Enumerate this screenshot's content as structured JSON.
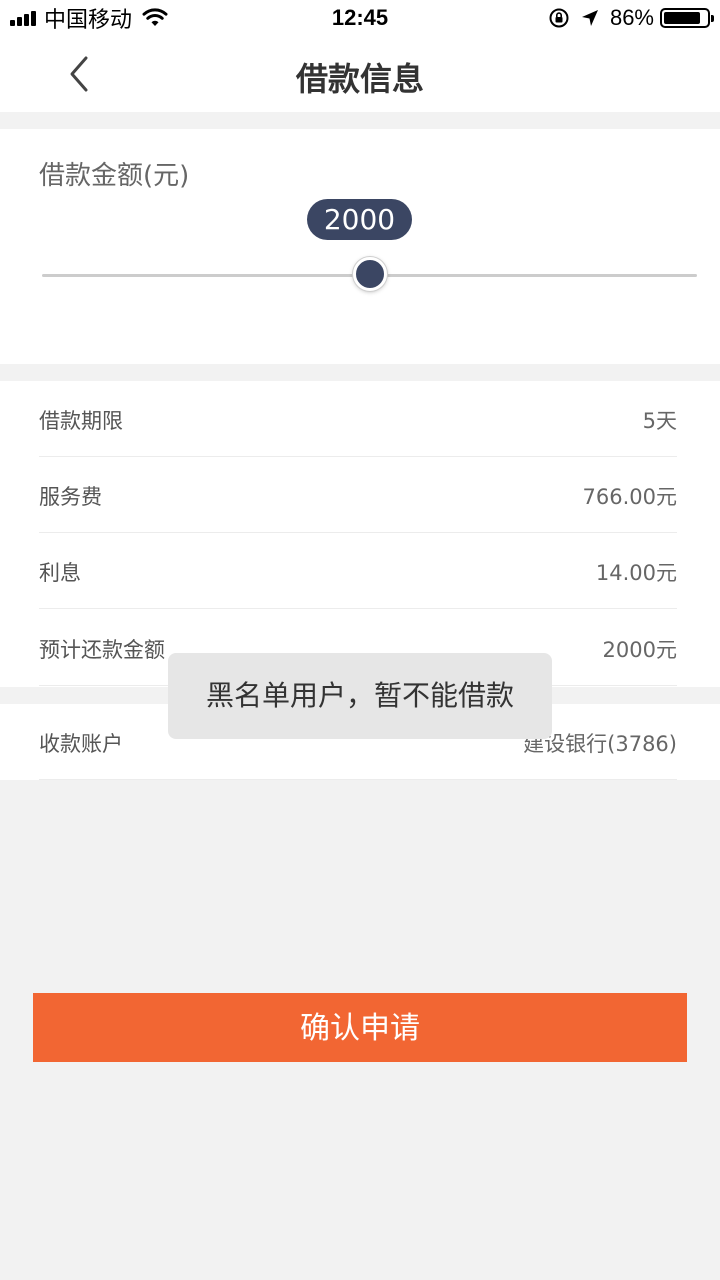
{
  "status_bar": {
    "carrier": "中国移动",
    "time": "12:45",
    "battery_percent": "86%",
    "battery_level": 0.86,
    "icons": [
      "signal-icon",
      "wifi-icon",
      "rotation-lock-icon",
      "location-arrow-icon",
      "battery-icon"
    ]
  },
  "nav": {
    "title": "借款信息",
    "back_icon": "chevron-left-icon"
  },
  "amount": {
    "label": "借款金额(元)",
    "value": "2000",
    "slider_position": 0.5
  },
  "details": [
    {
      "label": "借款期限",
      "value": "5天"
    },
    {
      "label": "服务费",
      "value": "766.00元"
    },
    {
      "label": "利息",
      "value": "14.00元"
    },
    {
      "label": "预计还款金额",
      "value": "2000元"
    }
  ],
  "account": {
    "label": "收款账户",
    "value": "建设银行(3786)"
  },
  "toast": {
    "message": "黑名单用户，暂不能借款"
  },
  "submit": {
    "label": "确认申请"
  },
  "colors": {
    "accent": "#f26633",
    "slider_dark": "#3b4663",
    "background": "#f2f2f2"
  }
}
